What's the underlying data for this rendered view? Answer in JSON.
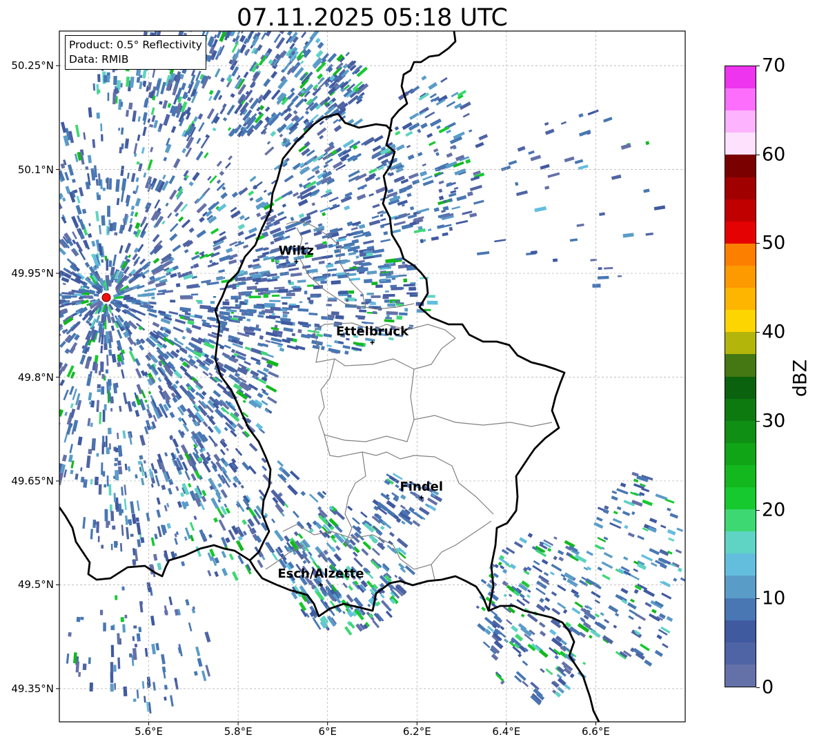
{
  "title": "07.11.2025 05:18 UTC",
  "info": {
    "product": "Product: 0.5° Reflectivity",
    "data": "Data: RMIB"
  },
  "axes": {
    "lat_ticks": [
      {
        "value": 50.25,
        "label": "50.25°N"
      },
      {
        "value": 50.1,
        "label": "50.1°N"
      },
      {
        "value": 49.95,
        "label": "49.95°N"
      },
      {
        "value": 49.8,
        "label": "49.8°N"
      },
      {
        "value": 49.65,
        "label": "49.65°N"
      },
      {
        "value": 49.5,
        "label": "49.5°N"
      },
      {
        "value": 49.35,
        "label": "49.35°N"
      }
    ],
    "lon_ticks": [
      {
        "value": 5.6,
        "label": "5.6°E"
      },
      {
        "value": 5.8,
        "label": "5.8°E"
      },
      {
        "value": 6.0,
        "label": "6°E"
      },
      {
        "value": 6.2,
        "label": "6.2°E"
      },
      {
        "value": 6.4,
        "label": "6.4°E"
      },
      {
        "value": 6.6,
        "label": "6.6°E"
      }
    ]
  },
  "cities": [
    {
      "name": "Wiltz",
      "lon": 5.93,
      "lat": 49.967
    },
    {
      "name": "Ettelbruck",
      "lon": 6.1,
      "lat": 49.85
    },
    {
      "name": "Findel",
      "lon": 6.21,
      "lat": 49.626
    },
    {
      "name": "Esch/Alzette",
      "lon": 5.985,
      "lat": 49.5
    }
  ],
  "radar_site": {
    "lon": 5.505,
    "lat": 49.915,
    "color": "#ee1111"
  },
  "colorbar": {
    "label": "dBZ",
    "ticks": [
      "0",
      "10",
      "20",
      "30",
      "40",
      "50",
      "60",
      "70"
    ],
    "min": 0,
    "max": 70,
    "colors": [
      "#6471a8",
      "#4f64a4",
      "#405aa0",
      "#4877b3",
      "#5a9cc8",
      "#63bede",
      "#5fd3c4",
      "#3ed873",
      "#16c92e",
      "#12b81e",
      "#10a417",
      "#0f8f13",
      "#0d7a10",
      "#0b620e",
      "#457812",
      "#b3b50a",
      "#fdd500",
      "#fdb500",
      "#fd9a00",
      "#fd7f00",
      "#e50202",
      "#c00000",
      "#a10000",
      "#7a0000",
      "#fde1fd",
      "#fdb3fd",
      "#fd6efd",
      "#ee34ee"
    ]
  },
  "regions": {
    "country": "#000000",
    "canton": "#808080"
  }
}
